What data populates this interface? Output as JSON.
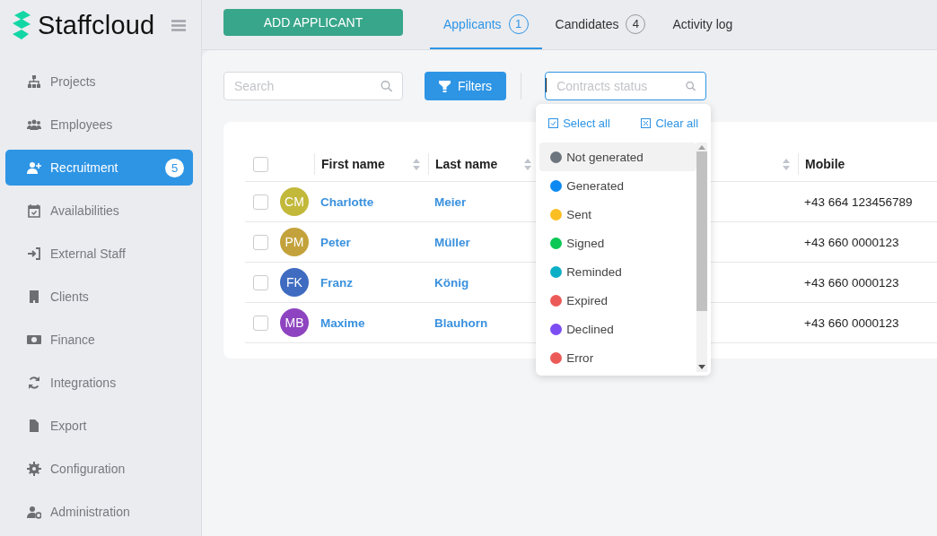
{
  "brand": {
    "name": "Staffcloud"
  },
  "sidebar": {
    "items": [
      {
        "label": "Projects",
        "selected": false
      },
      {
        "label": "Employees",
        "selected": false
      },
      {
        "label": "Recruitment",
        "selected": true,
        "badge": "5"
      },
      {
        "label": "Availabilities",
        "selected": false
      },
      {
        "label": "External Staff",
        "selected": false
      },
      {
        "label": "Clients",
        "selected": false
      },
      {
        "label": "Finance",
        "selected": false
      },
      {
        "label": "Integrations",
        "selected": false
      },
      {
        "label": "Export",
        "selected": false
      },
      {
        "label": "Configuration",
        "selected": false
      },
      {
        "label": "Administration",
        "selected": false
      }
    ]
  },
  "add_button": "ADD APPLICANT",
  "tabs": [
    {
      "label": "Applicants",
      "count": "1",
      "selected": true
    },
    {
      "label": "Candidates",
      "count": "4",
      "selected": false
    },
    {
      "label": "Activity log",
      "selected": false
    }
  ],
  "search": {
    "placeholder": "Search"
  },
  "filters_button": "Filters",
  "contracts_status": {
    "placeholder": "Contracts status",
    "expanded": true,
    "select_all": "Select all",
    "clear_all": "Clear all",
    "options": [
      {
        "label": "Not generated",
        "color": "#6c757d",
        "highlighted": true
      },
      {
        "label": "Generated",
        "color": "#0d8af2",
        "highlighted": false
      },
      {
        "label": "Sent",
        "color": "#fbbf24",
        "highlighted": false
      },
      {
        "label": "Signed",
        "color": "#0ac853",
        "highlighted": false
      },
      {
        "label": "Reminded",
        "color": "#0bb0c6",
        "highlighted": false
      },
      {
        "label": "Expired",
        "color": "#ec5a57",
        "highlighted": false
      },
      {
        "label": "Declined",
        "color": "#7c4df2",
        "highlighted": false
      },
      {
        "label": "Error",
        "color": "#ec5a57",
        "highlighted": false
      }
    ]
  },
  "table": {
    "header_checked": false,
    "columns": [
      {
        "label": "First name",
        "sortable": true
      },
      {
        "label": "Last name",
        "sortable": true
      },
      {
        "sortable": true
      },
      {
        "label": "Mobile"
      }
    ],
    "rows": [
      {
        "checked": false,
        "initials": "CM",
        "color": "#c2b83a",
        "first_name": "Charlotte",
        "last_name": "Meier",
        "mobile": "+43 664 123456789"
      },
      {
        "checked": false,
        "initials": "PM",
        "color": "#c3a23c",
        "first_name": "Peter",
        "last_name": "Müller",
        "mobile": "+43 660 0000123"
      },
      {
        "checked": false,
        "initials": "FK",
        "color": "#3f6cc0",
        "first_name": "Franz",
        "last_name": "König",
        "mobile": "+43 660 0000123"
      },
      {
        "checked": false,
        "initials": "MB",
        "color": "#8e44c0",
        "first_name": "Maxime",
        "last_name": "Blauhorn",
        "mobile": "+43 660 0000123"
      }
    ]
  }
}
